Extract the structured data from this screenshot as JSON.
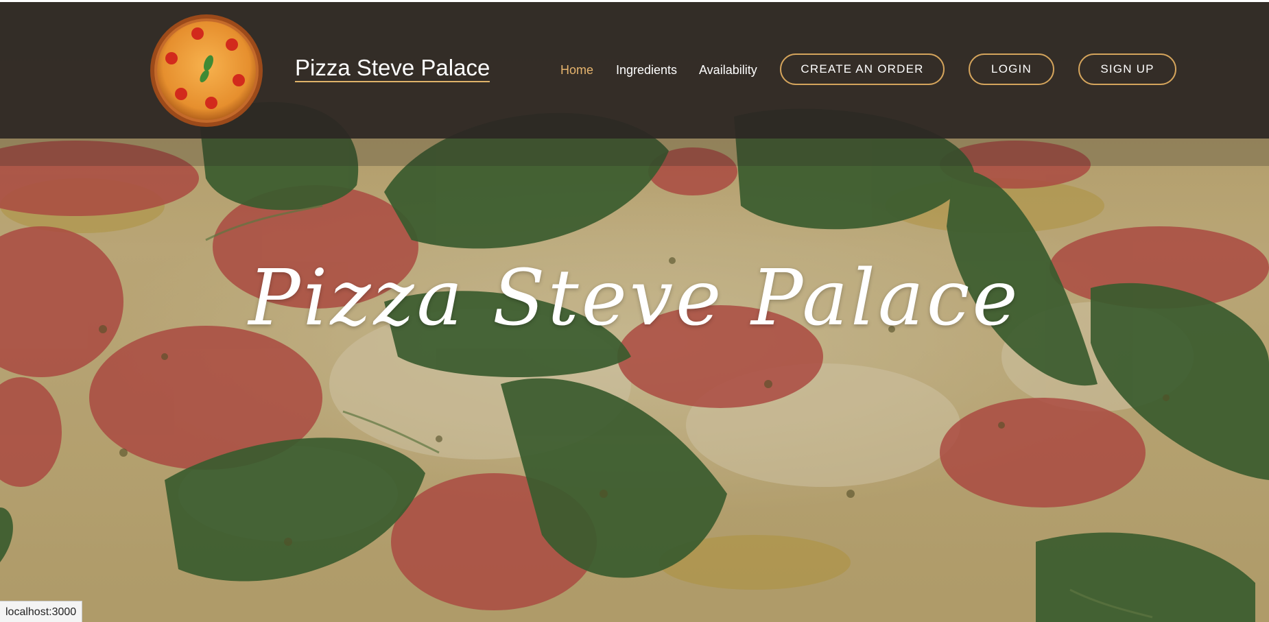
{
  "brand": {
    "name": "Pizza Steve Palace",
    "logo_icon": "pizza-logo-icon"
  },
  "nav": {
    "links": [
      {
        "label": "Home",
        "active": true
      },
      {
        "label": "Ingredients",
        "active": false
      },
      {
        "label": "Availability",
        "active": false
      }
    ],
    "buttons": [
      {
        "label": "CREATE AN ORDER"
      },
      {
        "label": "LOGIN"
      },
      {
        "label": "SIGN UP"
      }
    ]
  },
  "hero": {
    "title": "Pizza Steve Palace",
    "background": "pizza-photo"
  },
  "status_bar": {
    "url": "localhost:3000"
  },
  "colors": {
    "accent": "#e6b46e",
    "button_border": "#d4a45c",
    "navbar_bg": "#2c2623",
    "text": "#ffffff"
  }
}
